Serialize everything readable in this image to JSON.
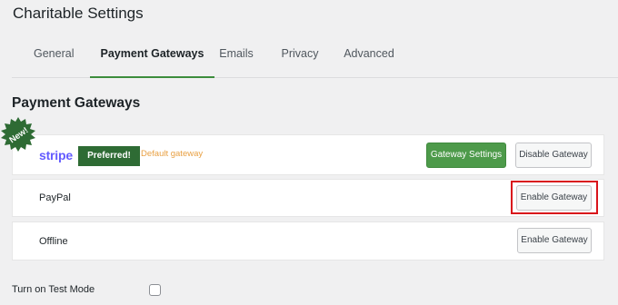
{
  "page": {
    "title": "Charitable Settings"
  },
  "tabs": [
    {
      "label": "General"
    },
    {
      "label": "Payment Gateways"
    },
    {
      "label": "Emails"
    },
    {
      "label": "Privacy"
    },
    {
      "label": "Advanced"
    }
  ],
  "active_tab": "Payment Gateways",
  "section": {
    "title": "Payment Gateways"
  },
  "gateways": {
    "stripe": {
      "name": "stripe",
      "badge": "Preferred!",
      "note": "Default gateway",
      "new_label": "New!",
      "settings_button": "Gateway Settings",
      "action_button": "Disable Gateway"
    },
    "paypal": {
      "name": "PayPal",
      "action_button": "Enable Gateway"
    },
    "offline": {
      "name": "Offline",
      "action_button": "Enable Gateway"
    }
  },
  "test_mode": {
    "label": "Turn on Test Mode",
    "checked": false
  },
  "colors": {
    "accent_green": "#4d9a4a",
    "badge_green": "#2e6b34",
    "stripe_purple": "#635bff",
    "default_note": "#e8a043",
    "highlight_red": "#d9141b"
  }
}
